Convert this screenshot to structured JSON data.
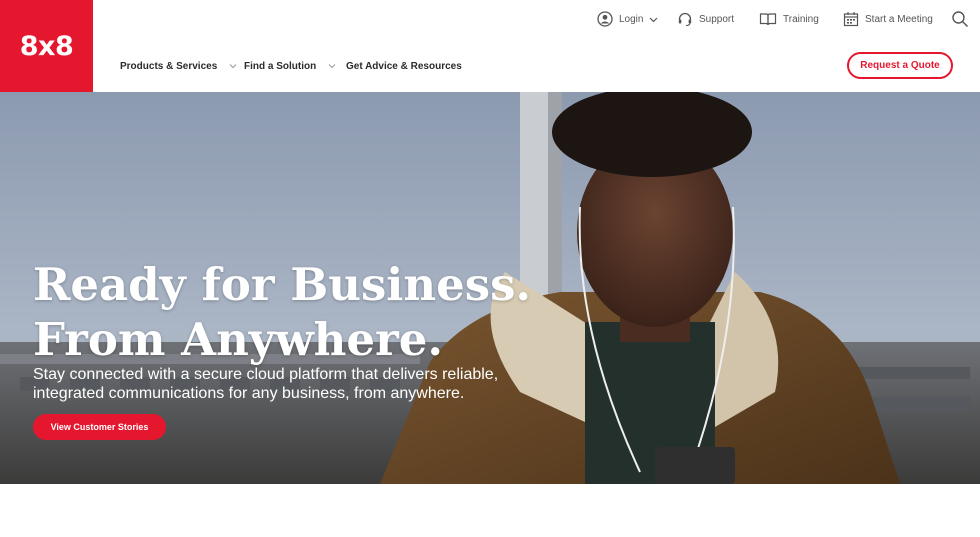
{
  "brand": {
    "logo_text": "8x8",
    "accent": "#e5172f"
  },
  "utility_nav": {
    "login": "Login",
    "support": "Support",
    "training": "Training",
    "meeting": "Start a Meeting"
  },
  "main_nav": {
    "products": "Products & Services",
    "solution": "Find a Solution",
    "advice": "Get Advice & Resources"
  },
  "cta": {
    "quote": "Request a Quote"
  },
  "hero": {
    "title_line1": "Ready for Business.",
    "title_line2": "From Anywhere.",
    "subtitle": "Stay connected with a secure cloud platform that delivers reliable, integrated communications for any business, from anywhere.",
    "button": "View Customer Stories"
  },
  "icons": [
    "user-circle-icon",
    "chevron-down-icon",
    "headset-icon",
    "book-icon",
    "calendar-icon",
    "search-icon"
  ]
}
